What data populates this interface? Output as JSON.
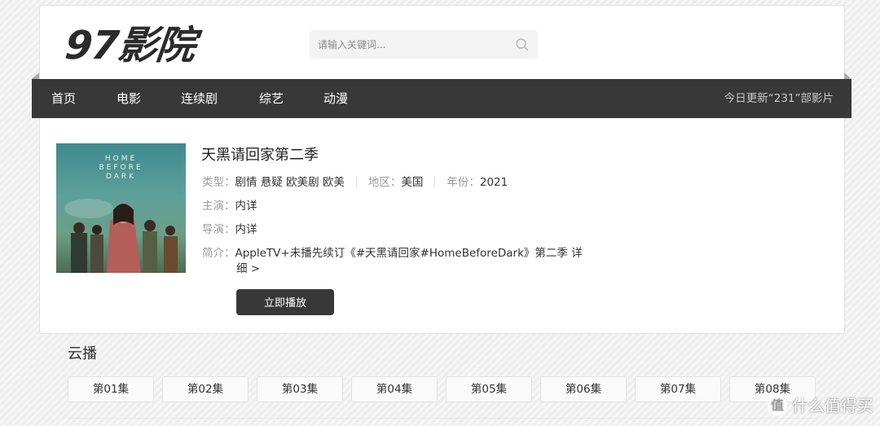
{
  "logo": {
    "text": "97影院"
  },
  "search": {
    "placeholder": "请输入关键词..."
  },
  "nav": {
    "items": [
      {
        "label": "首页"
      },
      {
        "label": "电影"
      },
      {
        "label": "连续剧"
      },
      {
        "label": "综艺"
      },
      {
        "label": "动漫"
      }
    ],
    "status": "今日更新“231”部影片"
  },
  "detail": {
    "poster_text": "HOME\nBEFORE\nDARK",
    "title": "天黑请回家第二季",
    "type_label": "类型：",
    "type_value": "剧情 悬疑 欧美剧 欧美",
    "region_label": "地区：",
    "region_value": "美国",
    "year_label": "年份：",
    "year_value": "2021",
    "cast_label": "主演：",
    "cast_value": "内详",
    "director_label": "导演：",
    "director_value": "内详",
    "summary_label": "简介：",
    "summary_value": "AppleTV+未播先续订《#天黑请回家#HomeBeforeDark》第二季 详",
    "summary_more": "细 >",
    "play_label": "立即播放"
  },
  "playlist": {
    "title": "云播",
    "episodes": [
      "第01集",
      "第02集",
      "第03集",
      "第04集",
      "第05集",
      "第06集",
      "第07集",
      "第08集"
    ]
  },
  "watermark": {
    "badge": "值",
    "text": "什么值得买"
  }
}
